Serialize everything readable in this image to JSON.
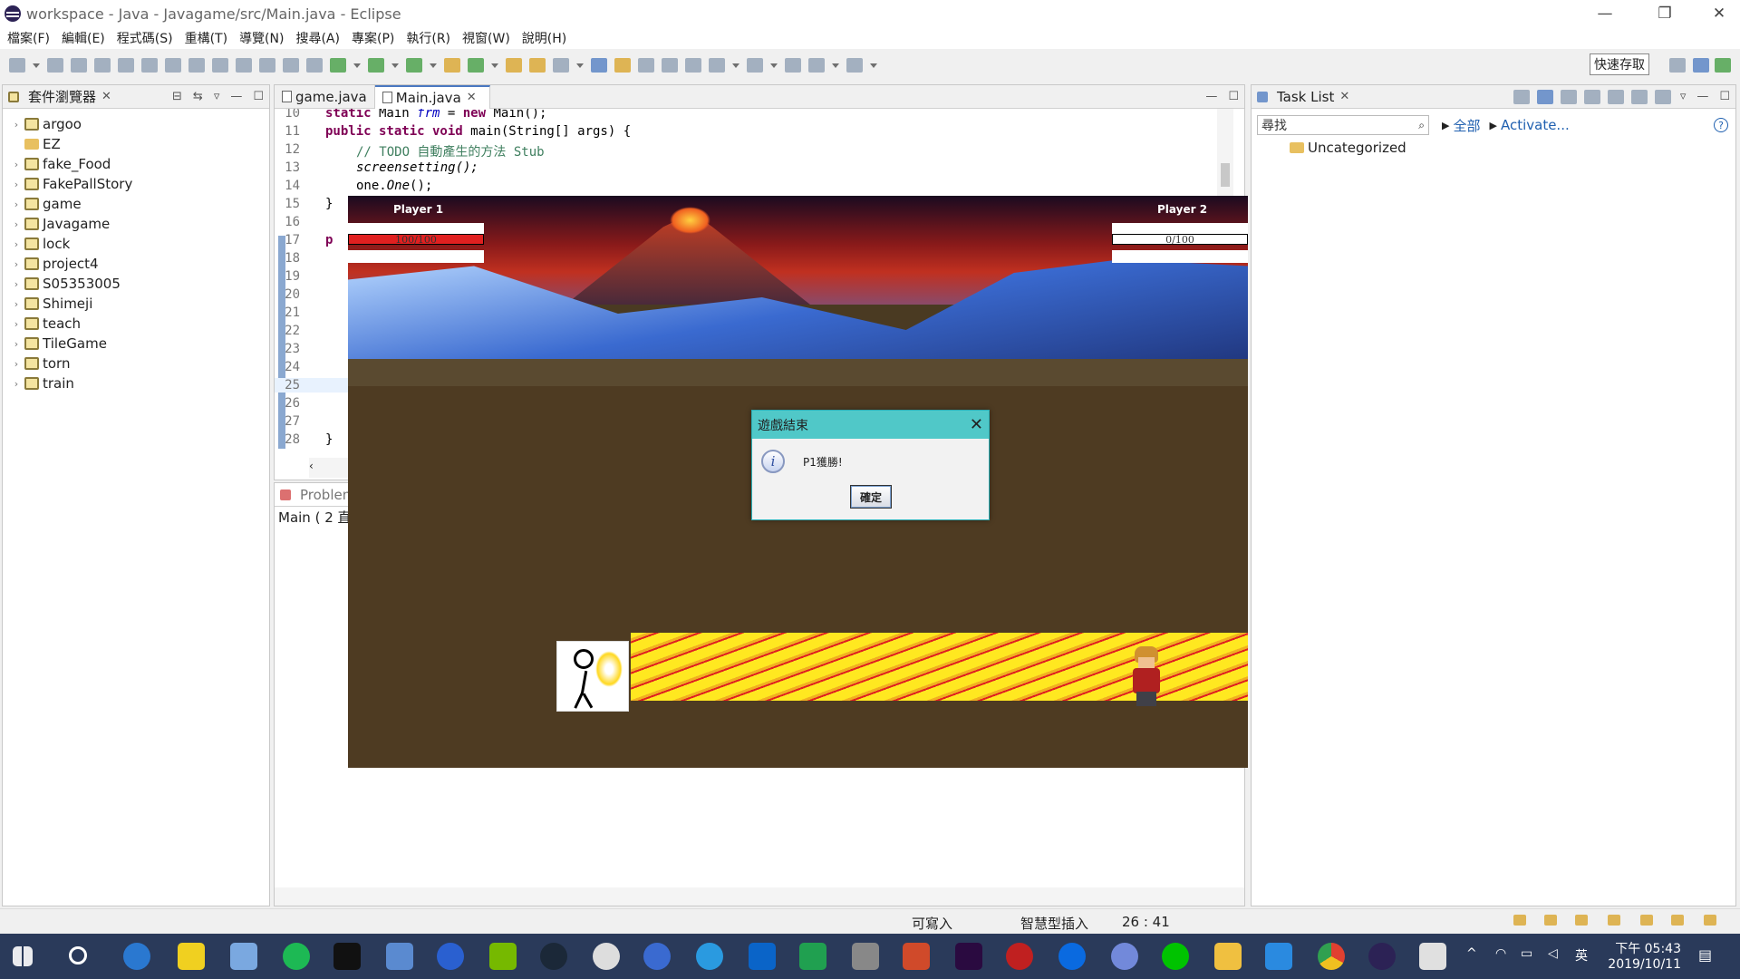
{
  "window": {
    "title": "workspace - Java - Javagame/src/Main.java - Eclipse",
    "minimize": "—",
    "restore": "❐",
    "close": "✕"
  },
  "menu": [
    "檔案(F)",
    "編輯(E)",
    "程式碼(S)",
    "重構(T)",
    "導覽(N)",
    "搜尋(A)",
    "專案(P)",
    "執行(R)",
    "視窗(W)",
    "說明(H)"
  ],
  "toolbar": {
    "quick_access": "快速存取"
  },
  "package_explorer": {
    "title": "套件瀏覽器",
    "projects": [
      "argoo",
      "EZ",
      "fake_Food",
      "FakePallStory",
      "game",
      "Javagame",
      "lock",
      "project4",
      "S05353005",
      "Shimeji",
      "teach",
      "TileGame",
      "torn",
      "train"
    ]
  },
  "editor": {
    "tabs": [
      {
        "label": "game.java"
      },
      {
        "label": "Main.java"
      }
    ],
    "lines": [
      {
        "n": "10",
        "t": "static Main frm = new Main();"
      },
      {
        "n": "11",
        "t": "public static void main(String[] args) {"
      },
      {
        "n": "12",
        "t": "// TODO 自動產生的方法 Stub"
      },
      {
        "n": "13",
        "t": "screensetting();"
      },
      {
        "n": "14",
        "t": "one.One();"
      },
      {
        "n": "15",
        "t": "}"
      },
      {
        "n": "16",
        "t": ""
      },
      {
        "n": "17",
        "t": "p"
      },
      {
        "n": "18",
        "t": ""
      },
      {
        "n": "19",
        "t": ""
      },
      {
        "n": "20",
        "t": ""
      },
      {
        "n": "21",
        "t": ""
      },
      {
        "n": "22",
        "t": ""
      },
      {
        "n": "23",
        "t": ""
      },
      {
        "n": "24",
        "t": ""
      },
      {
        "n": "25",
        "t": ""
      },
      {
        "n": "26",
        "t": ""
      },
      {
        "n": "27",
        "t": ""
      },
      {
        "n": "28",
        "t": "}"
      }
    ]
  },
  "problems": {
    "title": "Problem",
    "line": "Main ( 2 直"
  },
  "task_list": {
    "title": "Task List",
    "search_placeholder": "尋找",
    "filter_all": "全部",
    "activate": "Activate...",
    "category": "Uncategorized"
  },
  "game": {
    "player1": {
      "name": "Player 1",
      "hp_text": "100/100",
      "hp_fraction": 1.0
    },
    "player2": {
      "name": "Player 2",
      "hp_text": "0/100",
      "hp_fraction": 0.0
    }
  },
  "dialog": {
    "title": "遊戲結束",
    "message": "P1獲勝!",
    "ok": "確定",
    "close": "✕"
  },
  "status": {
    "writable": "可寫入",
    "insert_mode": "智慧型插入",
    "position": "26 : 41"
  },
  "taskbar": {
    "time": "下午 05:43",
    "date": "2019/10/11",
    "ime": "英"
  }
}
